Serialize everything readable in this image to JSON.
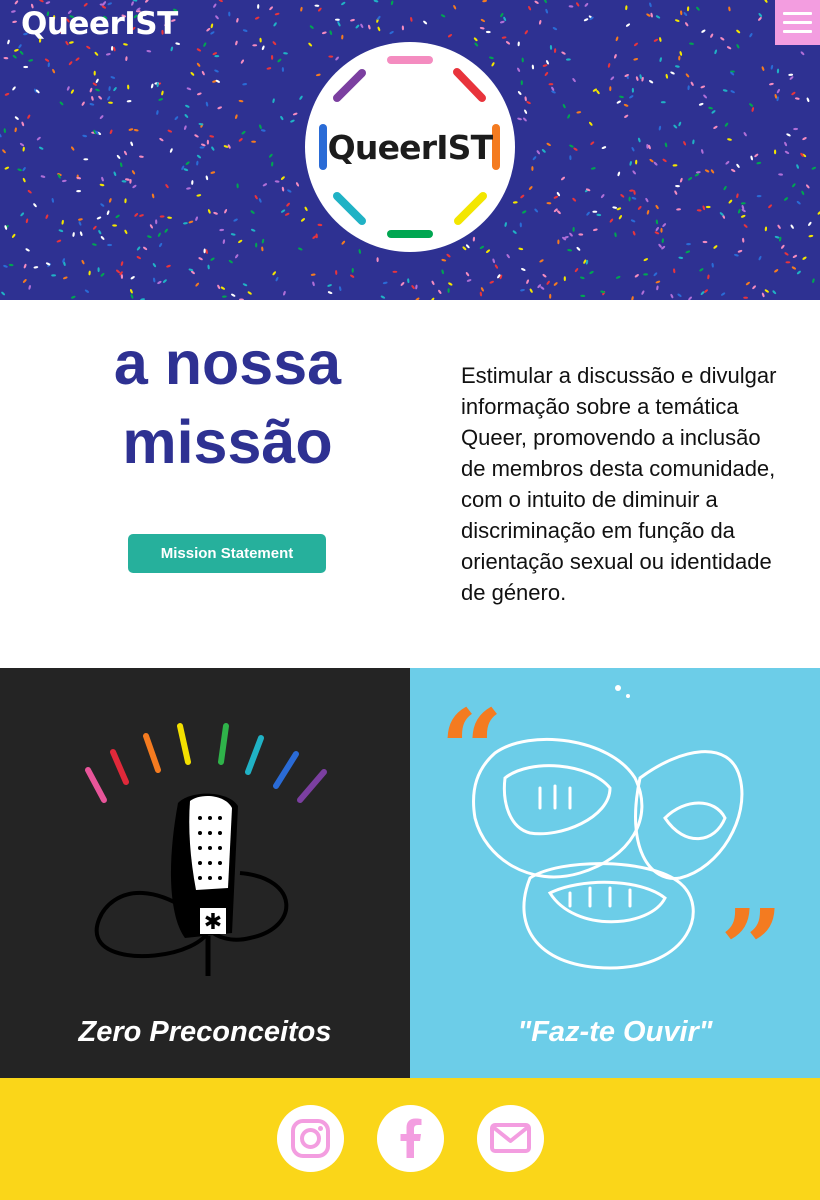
{
  "header": {
    "brand": "QueerIST",
    "logo_text": "QueerIST",
    "menu_icon": "hamburger-menu-icon",
    "background_color": "#2e3192",
    "menu_color": "#f39de0"
  },
  "mission": {
    "title_line1": "a nossa",
    "title_line2": "missão",
    "button_label": "Mission Statement",
    "text": "Estimular a discussão e divulgar informação sobre a temática Queer, promovendo a inclusão de membros desta comunidade, com o intuito de diminuir a discriminação em função da orientação sexual ou identidade de género.",
    "title_color": "#2e3192",
    "button_color": "#26b09c"
  },
  "tiles": [
    {
      "caption": "Zero Preconceitos",
      "icon": "rainbow-microphone-icon",
      "background": "#242424"
    },
    {
      "caption": "\"Faz-te Ouvir\"",
      "icon": "talking-mouths-icon",
      "background": "#6ccde8"
    }
  ],
  "footer": {
    "background": "#fad619",
    "social": [
      {
        "icon": "instagram-icon"
      },
      {
        "icon": "facebook-icon"
      },
      {
        "icon": "mail-icon"
      }
    ],
    "icon_color": "#f39de0"
  }
}
